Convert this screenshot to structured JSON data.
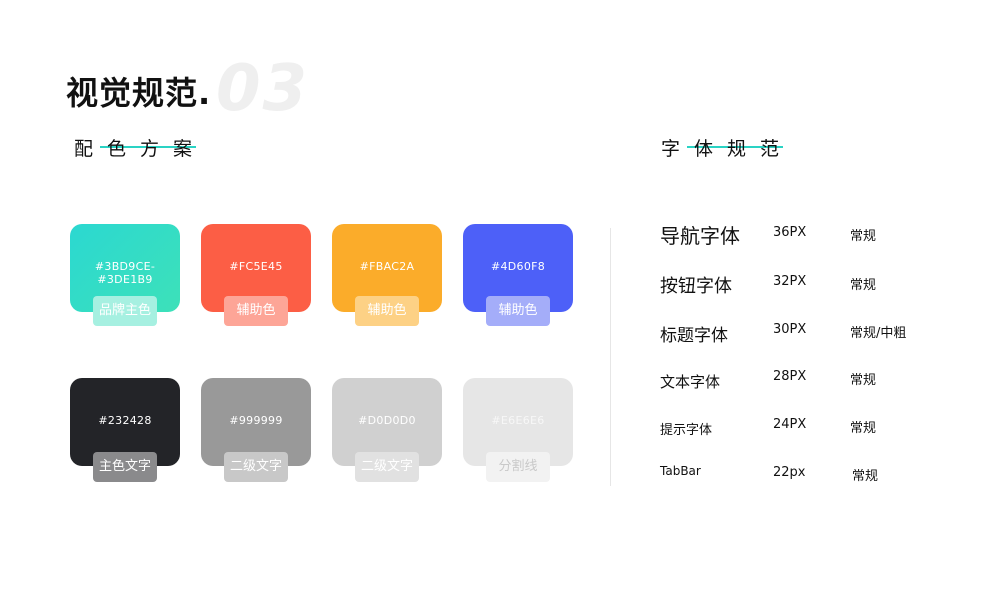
{
  "page": {
    "title": "视觉规范.",
    "title_number": "03"
  },
  "color_section": {
    "heading": "配色方案",
    "swatches": [
      {
        "code": "#3BD9CE-#3DE1B9",
        "label": "品牌主色",
        "color": "#2fdcc5",
        "tag_color": "#a6f0e1"
      },
      {
        "code": "#FC5E45",
        "label": "辅助色",
        "color": "#fc5e45",
        "tag_color": "#fda597"
      },
      {
        "code": "#FBAC2A",
        "label": "辅助色",
        "color": "#fbac2a",
        "tag_color": "#fdd185"
      },
      {
        "code": "#4D60F8",
        "label": "辅助色",
        "color": "#4d60f8",
        "tag_color": "#a4adf9"
      },
      {
        "code": "#232428",
        "label": "主色文字",
        "color": "#232428",
        "tag_color": "#8a8a8c"
      },
      {
        "code": "#999999",
        "label": "二级文字",
        "color": "#999999",
        "tag_color": "#c8c8c8"
      },
      {
        "code": "#D0D0D0",
        "label": "二级文字",
        "color": "#d0d0d0",
        "tag_color": "#e1e1e1"
      },
      {
        "code": "#E6E6E6",
        "label": "分割线",
        "color": "#e6e6e6",
        "tag_color": "#f2f2f2"
      }
    ]
  },
  "font_section": {
    "heading": "字体规范",
    "rows": [
      {
        "name": "导航字体",
        "size": "36PX",
        "weight": "常规"
      },
      {
        "name": "按钮字体",
        "size": "32PX",
        "weight": "常规"
      },
      {
        "name": "标题字体",
        "size": "30PX",
        "weight": "常规/中粗"
      },
      {
        "name": "文本字体",
        "size": "28PX",
        "weight": "常规"
      },
      {
        "name": "提示字体",
        "size": "24PX",
        "weight": "常规"
      },
      {
        "name": "TabBar",
        "size": "22px",
        "weight": "常规"
      }
    ]
  },
  "colors": {
    "accent_line": "#2ad3c4",
    "brand_gradient_start": "#2bd9cf",
    "brand_gradient_end": "#3de1b9"
  }
}
